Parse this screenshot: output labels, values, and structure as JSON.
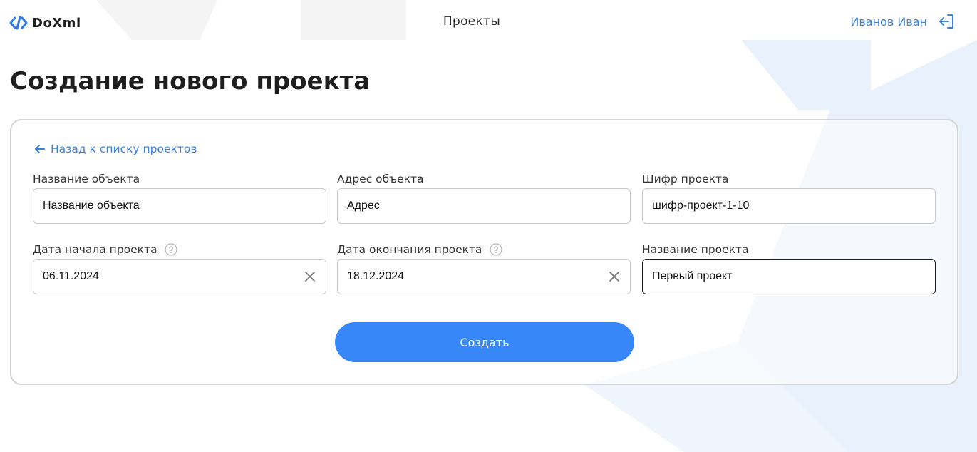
{
  "header": {
    "logo_text": "DoXml",
    "nav_title": "Проекты",
    "user_name": "Иванов Иван"
  },
  "page": {
    "title": "Создание нового проекта"
  },
  "form": {
    "back_link": "Назад к списку проектов",
    "fields": [
      {
        "label": "Название объекта",
        "value": "Название объекта"
      },
      {
        "label": "Адрес объекта",
        "value": "Адрес"
      },
      {
        "label": "Шифр проекта",
        "value": "шифр-проект-1-10"
      },
      {
        "label": "Дата начала проекта",
        "value": "06.11.2024"
      },
      {
        "label": "Дата окончания проекта",
        "value": "18.12.2024"
      },
      {
        "label": "Название проекта",
        "value": "Первый проект"
      }
    ],
    "submit_label": "Создать"
  },
  "colors": {
    "accent": "#3787f9",
    "link": "#3d83dc",
    "background_deco": "#eaf2fd"
  },
  "icons": [
    "code-logo-icon",
    "logout-icon",
    "arrow-left-icon",
    "help-circle-icon",
    "clear-icon"
  ]
}
